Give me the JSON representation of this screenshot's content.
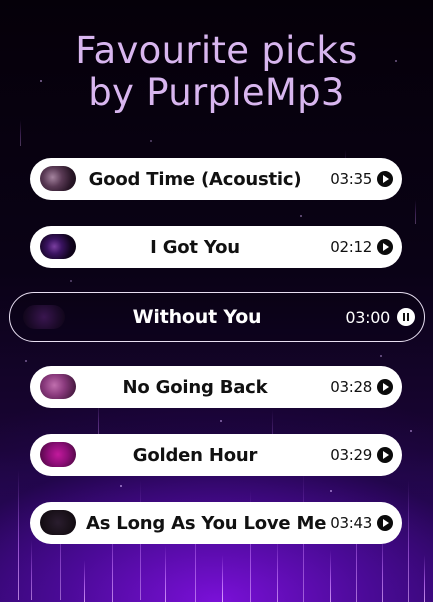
{
  "header": {
    "title_line1": "Favourite picks",
    "title_line2": "by PurpleMp3"
  },
  "playlist": {
    "tracks": [
      {
        "title": "Good Time (Acoustic)",
        "duration": "03:35",
        "state": "play-icon"
      },
      {
        "title": "I Got You",
        "duration": "02:12",
        "state": "play-icon"
      },
      {
        "title": "Without You",
        "duration": "03:00",
        "state": "pause-icon",
        "active": true
      },
      {
        "title": "No Going Back",
        "duration": "03:28",
        "state": "play-icon"
      },
      {
        "title": "Golden Hour",
        "duration": "03:29",
        "state": "play-icon"
      },
      {
        "title": "As Long As You Love Me",
        "duration": "03:43",
        "state": "play-icon"
      }
    ]
  },
  "colors": {
    "title": "#d8b6ef",
    "accent_purple": "#7a10d8",
    "row_bg": "#ffffff",
    "background": "#06010d"
  }
}
